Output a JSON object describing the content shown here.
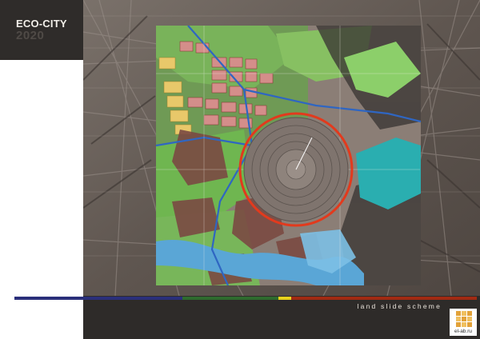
{
  "brand": {
    "title": "ECO-CITY",
    "year": "2020"
  },
  "caption": "land slide scheme",
  "logo": {
    "text": "el-ab.ru"
  },
  "colors": {
    "brand_block": "#2f2c2a",
    "stripe_blue": "#2a2f7a",
    "stripe_green": "#2e6b2e",
    "stripe_yellow": "#e8d21c",
    "stripe_red": "#a12a12",
    "crater_ring": "#e23a1d",
    "river": "#5aa6d6",
    "lagoon": "#2ab0b0"
  },
  "map": {
    "description_icon": "city-plan-map",
    "overlay_icon": "landslide-radius-circle"
  }
}
